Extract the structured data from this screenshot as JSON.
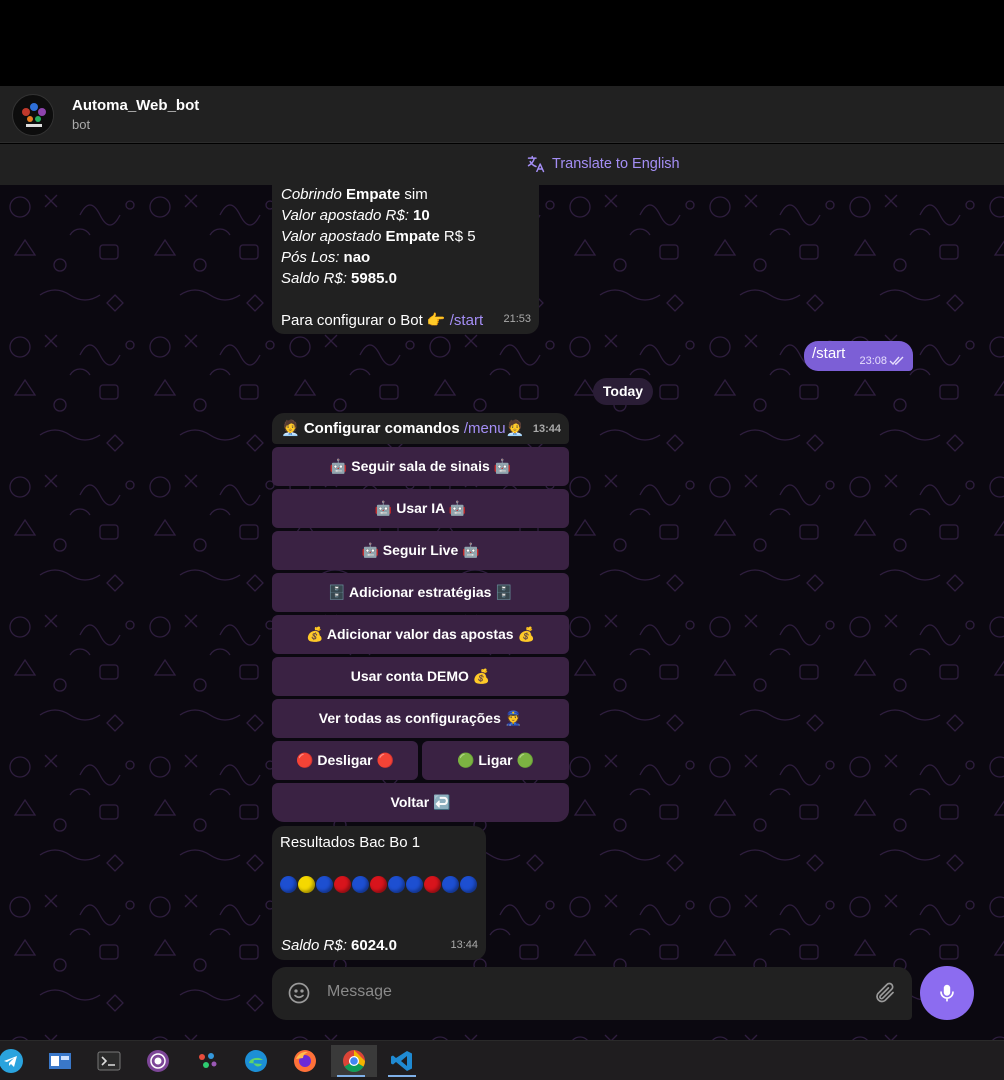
{
  "header": {
    "title": "Automa_Web_bot",
    "subtitle": "bot"
  },
  "translate": {
    "label": "Translate to English"
  },
  "message_prev": {
    "l1_i": "Cobrindo",
    "l1_b": " Empate",
    "l1_t": " sim",
    "l2_i": "Valor apostado R$:",
    "l2_b": " 10",
    "l3_i": "Valor apostado",
    "l3_b": " Empate",
    "l3_t": " R$ 5",
    "l4_i": "Pós Los:",
    "l4_b": " nao",
    "l5_i": "Saldo R$:",
    "l5_b": " 5985.0",
    "config_text": "Para configurar o Bot 👉 ",
    "config_link": "/start",
    "time": "21:53"
  },
  "outgoing": {
    "text": "/start",
    "time": "23:08"
  },
  "day_separator": "Today",
  "menu_message": {
    "text": "🧑‍💼 Configurar comandos ",
    "link": "/menu",
    "emoji_end": "🧑‍💼",
    "time": "13:44"
  },
  "keyboard": [
    {
      "label": "🤖 Seguir sala de sinais 🤖"
    },
    {
      "label": "🤖 Usar IA 🤖"
    },
    {
      "label": "🤖 Seguir Live 🤖"
    },
    {
      "label": "🗄️ Adicionar estratégias 🗄️"
    },
    {
      "label": "💰 Adicionar valor das apostas 💰"
    },
    {
      "label": "Usar conta DEMO 💰"
    },
    {
      "label": "Ver todas as configurações 👮"
    },
    {
      "label": "🔴 Desligar 🔴"
    },
    {
      "label": "🟢 Ligar 🟢"
    },
    {
      "label": "Voltar ↩️"
    }
  ],
  "results": {
    "title": "Resultados Bac Bo 1",
    "balls": [
      "blue",
      "yellow",
      "blue",
      "red",
      "blue",
      "red",
      "blue",
      "blue",
      "red",
      "blue",
      "blue"
    ],
    "saldo_label": "Saldo R$:",
    "saldo_value": " 6024.0",
    "time": "13:44"
  },
  "composer": {
    "placeholder": "Message"
  },
  "colors": {
    "accent": "#8c6cf0",
    "link": "#a48ef5",
    "bubble": "#212121",
    "keyboard_button": "#3a2243",
    "ball_blue": "#1d4fd1",
    "ball_red": "#d8141c",
    "ball_yellow": "#f5d800"
  },
  "taskbar": [
    "telegram-icon",
    "explorer-icon",
    "terminal-icon",
    "tor-browser-icon",
    "app-icon",
    "edge-icon",
    "firefox-icon",
    "chrome-icon",
    "vscode-icon"
  ]
}
